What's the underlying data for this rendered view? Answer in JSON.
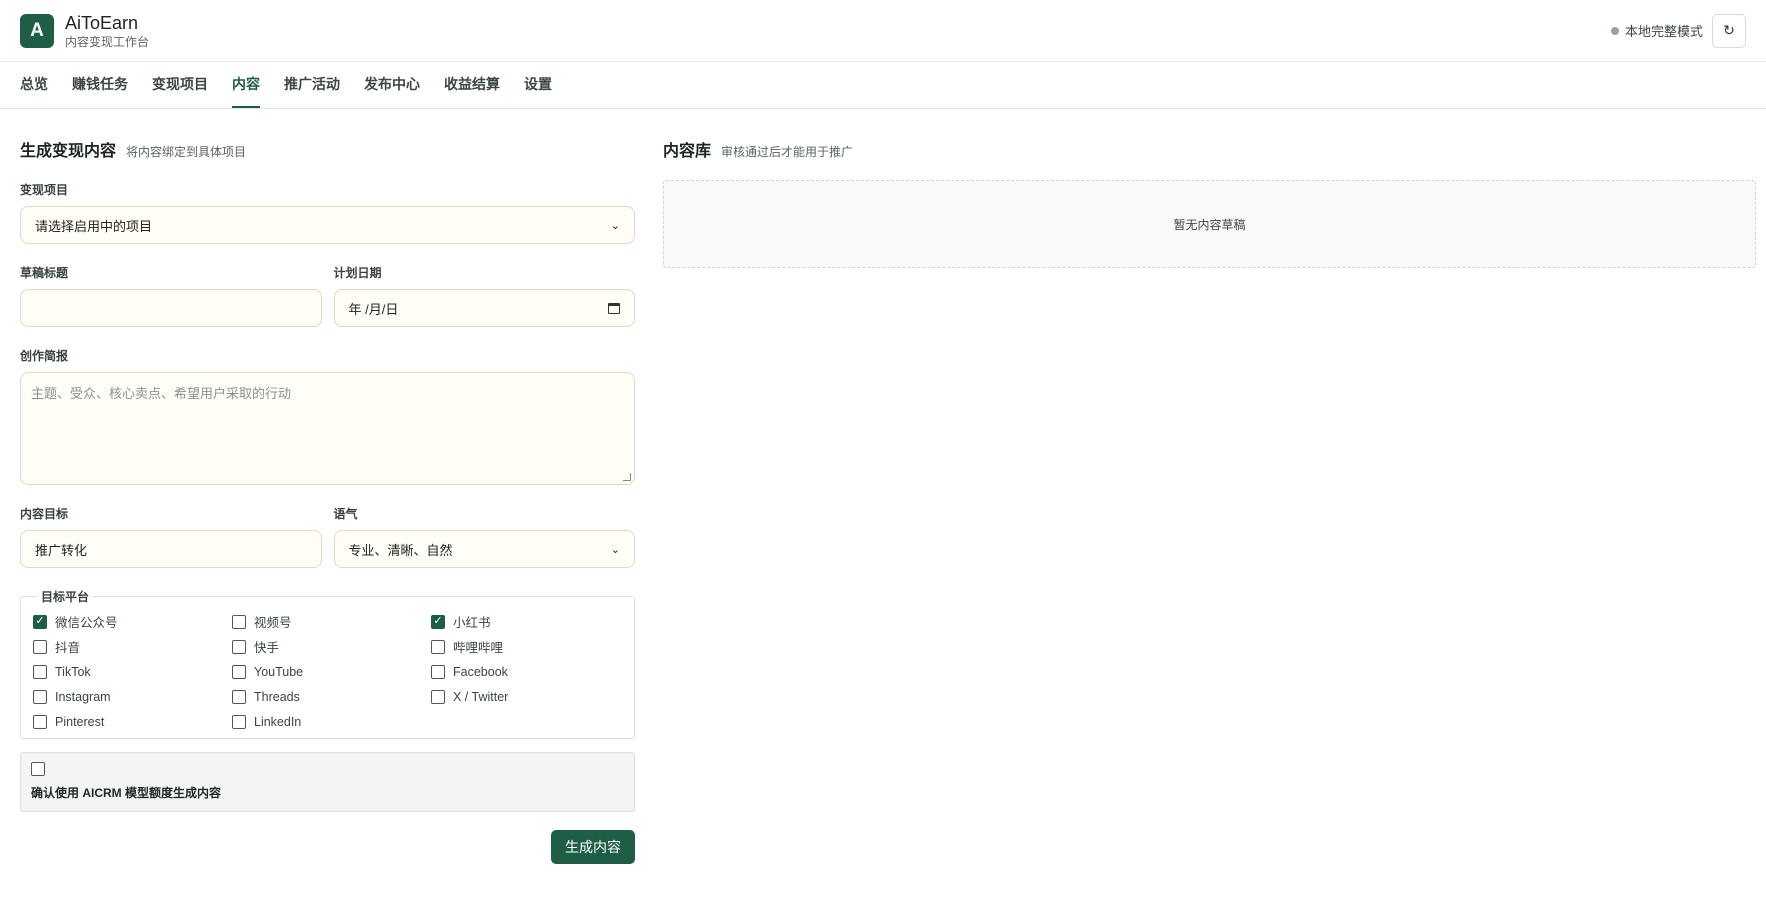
{
  "header": {
    "logo_letter": "A",
    "app_name": "AiToEarn",
    "app_subtitle": "内容变现工作台",
    "mode_label": "本地完整模式",
    "refresh_glyph": "↻"
  },
  "nav": {
    "items": [
      {
        "label": "总览",
        "active": false
      },
      {
        "label": "赚钱任务",
        "active": false
      },
      {
        "label": "变现项目",
        "active": false
      },
      {
        "label": "内容",
        "active": true
      },
      {
        "label": "推广活动",
        "active": false
      },
      {
        "label": "发布中心",
        "active": false
      },
      {
        "label": "收益结算",
        "active": false
      },
      {
        "label": "设置",
        "active": false
      }
    ]
  },
  "generate": {
    "title": "生成变现内容",
    "subtitle": "将内容绑定到具体项目",
    "project_label": "变现项目",
    "project_value": "请选择启用中的项目",
    "draft_title_label": "草稿标题",
    "draft_title_value": "",
    "plan_date_label": "计划日期",
    "plan_date_value": "年 /月/日",
    "brief_label": "创作简报",
    "brief_placeholder": "主题、受众、核心卖点、希望用户采取的行动",
    "goal_label": "内容目标",
    "goal_value": "推广转化",
    "tone_label": "语气",
    "tone_value": "专业、清晰、自然",
    "platforms_legend": "目标平台",
    "platforms": [
      {
        "label": "微信公众号",
        "checked": true
      },
      {
        "label": "视频号",
        "checked": false
      },
      {
        "label": "小红书",
        "checked": true
      },
      {
        "label": "抖音",
        "checked": false
      },
      {
        "label": "快手",
        "checked": false
      },
      {
        "label": "哔哩哔哩",
        "checked": false
      },
      {
        "label": "TikTok",
        "checked": false
      },
      {
        "label": "YouTube",
        "checked": false
      },
      {
        "label": "Facebook",
        "checked": false
      },
      {
        "label": "Instagram",
        "checked": false
      },
      {
        "label": "Threads",
        "checked": false
      },
      {
        "label": "X / Twitter",
        "checked": false
      },
      {
        "label": "Pinterest",
        "checked": false
      },
      {
        "label": "LinkedIn",
        "checked": false
      }
    ],
    "confirm_checked": false,
    "confirm_text": "确认使用 AICRM 模型额度生成内容",
    "submit_label": "生成内容"
  },
  "library": {
    "title": "内容库",
    "subtitle": "审核通过后才能用于推广",
    "empty_text": "暂无内容草稿"
  },
  "colors": {
    "accent": "#1d5e45",
    "input_bg": "#fffdf5"
  }
}
